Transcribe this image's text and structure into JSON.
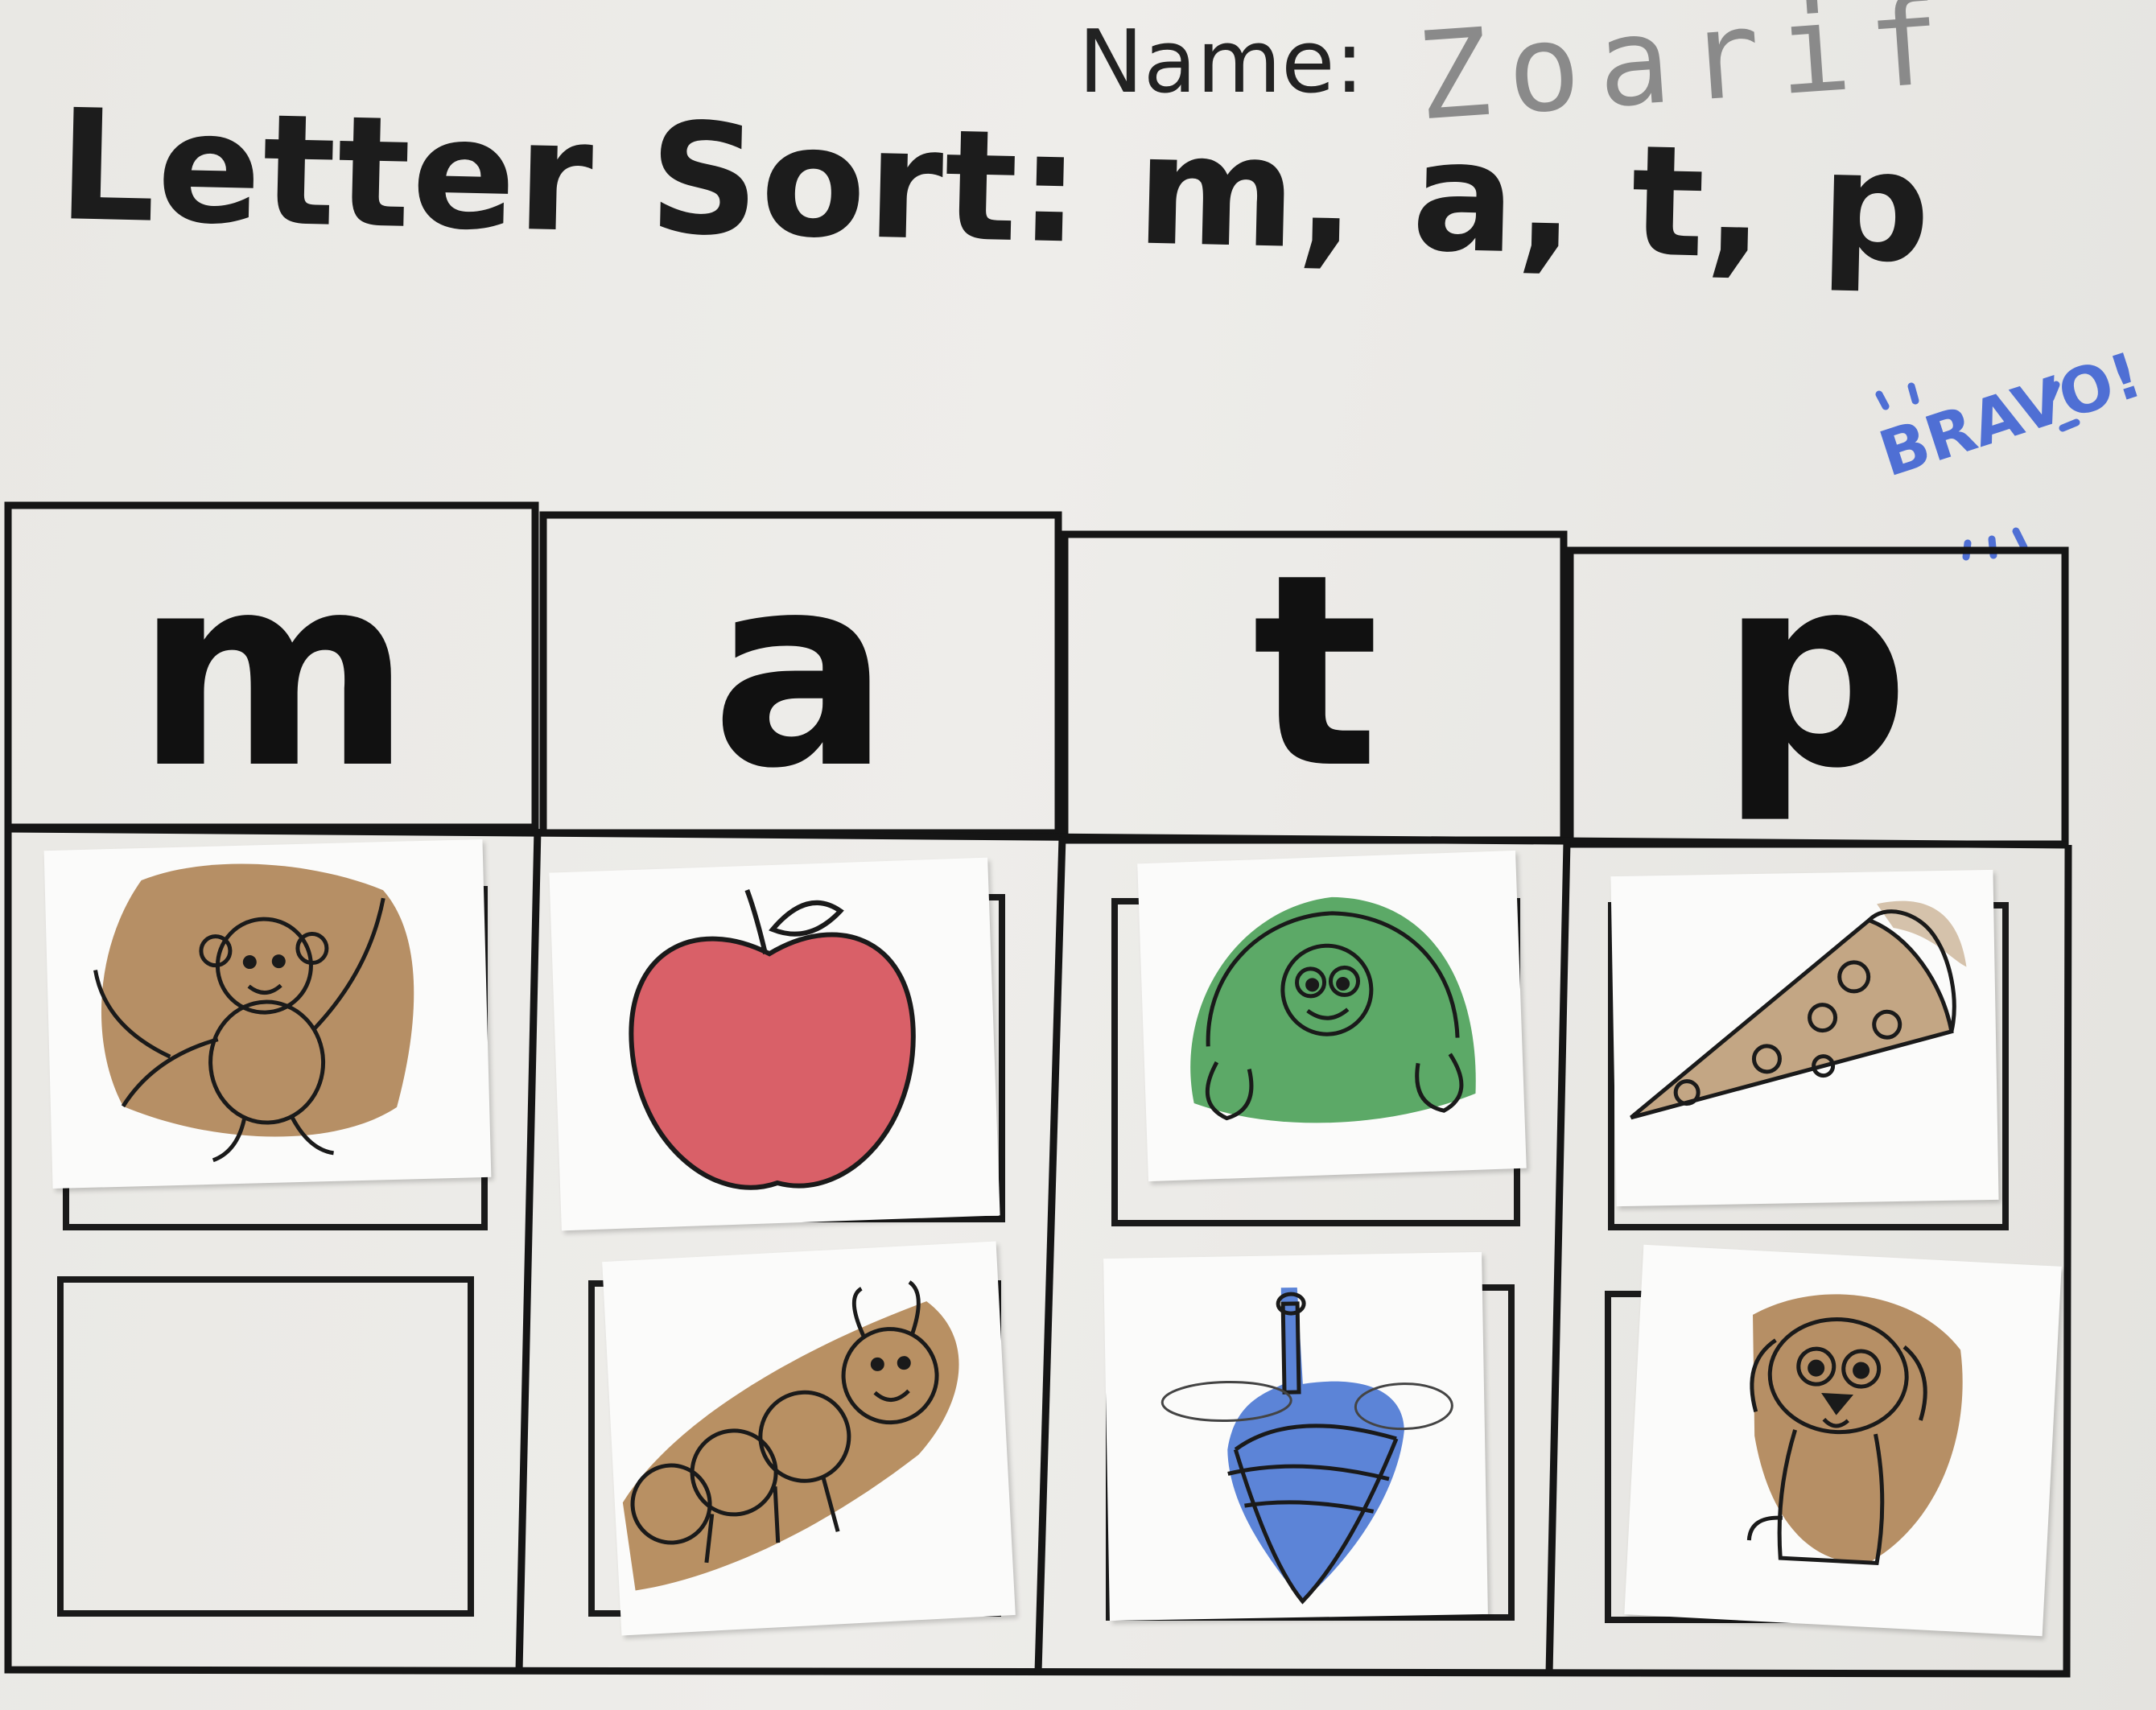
{
  "worksheet": {
    "title": "Letter Sort: m, a, t, p",
    "name_label": "Name:",
    "name_value": "Zoarif",
    "stamp_text": "BRAVO!",
    "columns": [
      {
        "letter": "m",
        "pictures": [
          "monkey-icon"
        ]
      },
      {
        "letter": "a",
        "pictures": [
          "apple-icon",
          "ant-icon"
        ]
      },
      {
        "letter": "t",
        "pictures": [
          "turtle-icon",
          "top-icon"
        ]
      },
      {
        "letter": "p",
        "pictures": [
          "pizza-icon",
          "puppy-icon"
        ]
      }
    ]
  },
  "colors": {
    "monkey": "#a97b4a",
    "apple": "#d2444e",
    "ant": "#ac7c48",
    "turtle": "#3f9a4c",
    "top": "#3f6fd0",
    "pizza": "#b0895c",
    "puppy": "#a97b4a",
    "stamp": "#4f6fd4"
  }
}
